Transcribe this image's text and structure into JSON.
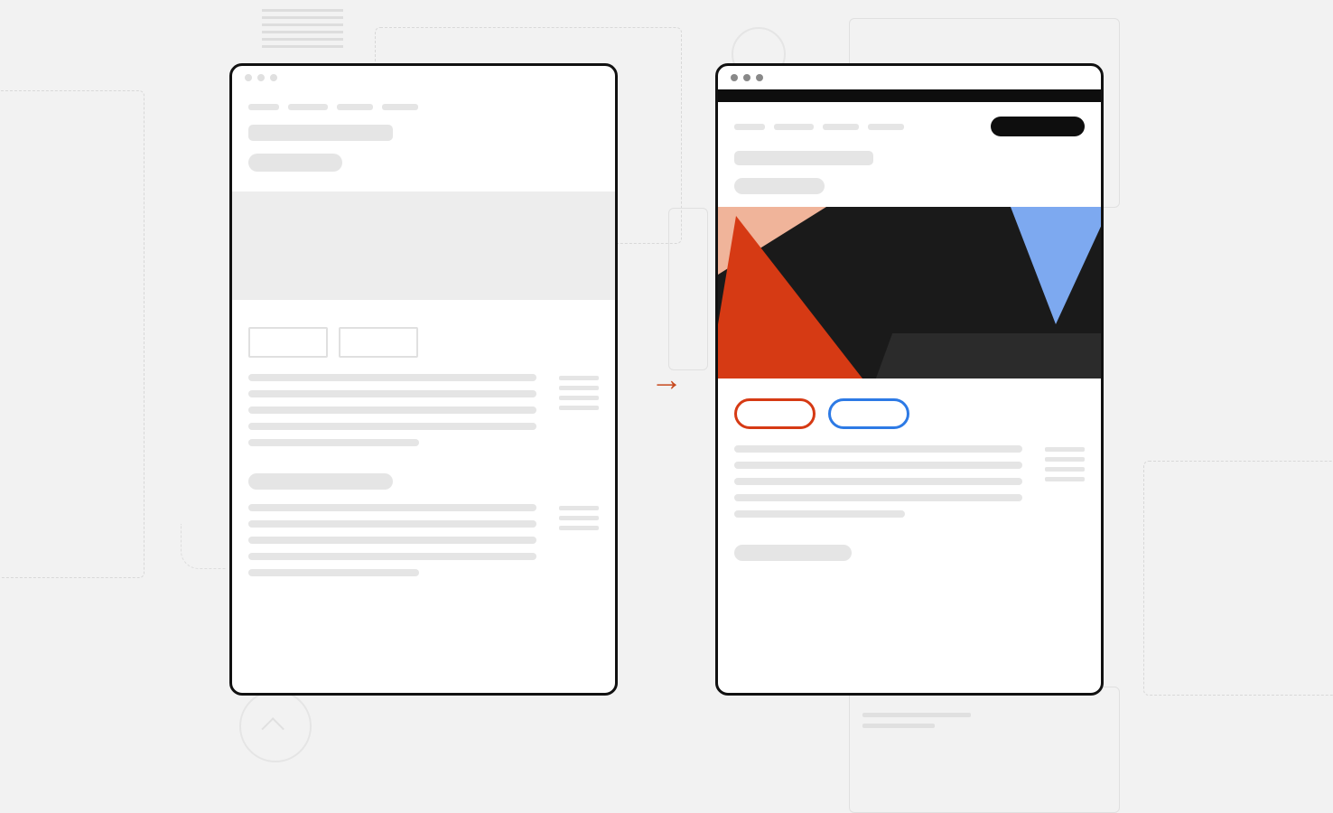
{
  "diagram": {
    "meaning": "wireframe-to-designed-page transformation",
    "arrow_direction": "right"
  },
  "wireframe": {
    "window_dots": 3,
    "nav_items": 4,
    "has_hero_placeholder": true,
    "outline_buttons": 2,
    "body_paragraphs": 2,
    "sidebar_line_groups": 2
  },
  "designed": {
    "window_dots": 3,
    "has_black_top_bar": true,
    "nav_items": 4,
    "has_cta_button": true,
    "hero_colors": [
      "#f0b49a",
      "#d63a14",
      "#1a1a1a",
      "#7da9f0",
      "#2b2b2b"
    ],
    "pill_buttons": [
      {
        "color": "#d63a14"
      },
      {
        "color": "#2d7ae5"
      }
    ],
    "body_paragraphs": 1,
    "sidebar_line_groups": 1
  },
  "colors": {
    "accent_orange": "#d63a14",
    "accent_blue": "#2d7ae5",
    "black": "#0e0e0e",
    "skeleton": "#e5e5e5",
    "background": "#f2f2f2"
  }
}
